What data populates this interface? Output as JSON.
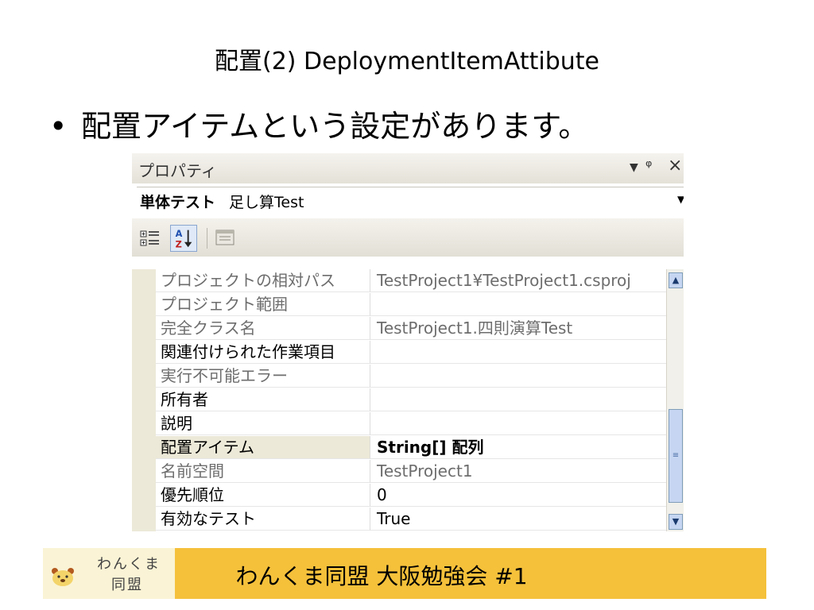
{
  "slide": {
    "title": "配置(2) DeploymentItemAttibute",
    "bullet_symbol": "•",
    "bullet": "配置アイテムという設定があります。"
  },
  "properties_window": {
    "title": "プロパティ",
    "object_name": "単体テスト",
    "object_type": "足し算Test",
    "rows": [
      {
        "name": "プロジェクトの相対パス",
        "value": "TestProject1¥TestProject1.csproj",
        "readonly": true
      },
      {
        "name": "プロジェクト範囲",
        "value": "",
        "readonly": true
      },
      {
        "name": "完全クラス名",
        "value": "TestProject1.四則演算Test",
        "readonly": true
      },
      {
        "name": "関連付けられた作業項目",
        "value": "",
        "readonly": false
      },
      {
        "name": "実行不可能エラー",
        "value": "",
        "readonly": true
      },
      {
        "name": "所有者",
        "value": "",
        "readonly": false
      },
      {
        "name": "説明",
        "value": "",
        "readonly": false
      },
      {
        "name": "配置アイテム",
        "value": "String[] 配列",
        "readonly": false,
        "selected": true,
        "bold": true
      },
      {
        "name": "名前空間",
        "value": "TestProject1",
        "readonly": true
      },
      {
        "name": "優先順位",
        "value": "0",
        "readonly": false
      },
      {
        "name": "有効なテスト",
        "value": "True",
        "readonly": false
      }
    ]
  },
  "footer": {
    "logo_line1": "わんくま",
    "logo_line2": "同盟",
    "caption": "わんくま同盟 大阪勉強会 #1"
  },
  "colors": {
    "footer_bar": "#f5c13b",
    "logo_box": "#faf3d5",
    "grid_margin": "#ece9d8",
    "scrollbar_accent": "#c6d6f2"
  }
}
